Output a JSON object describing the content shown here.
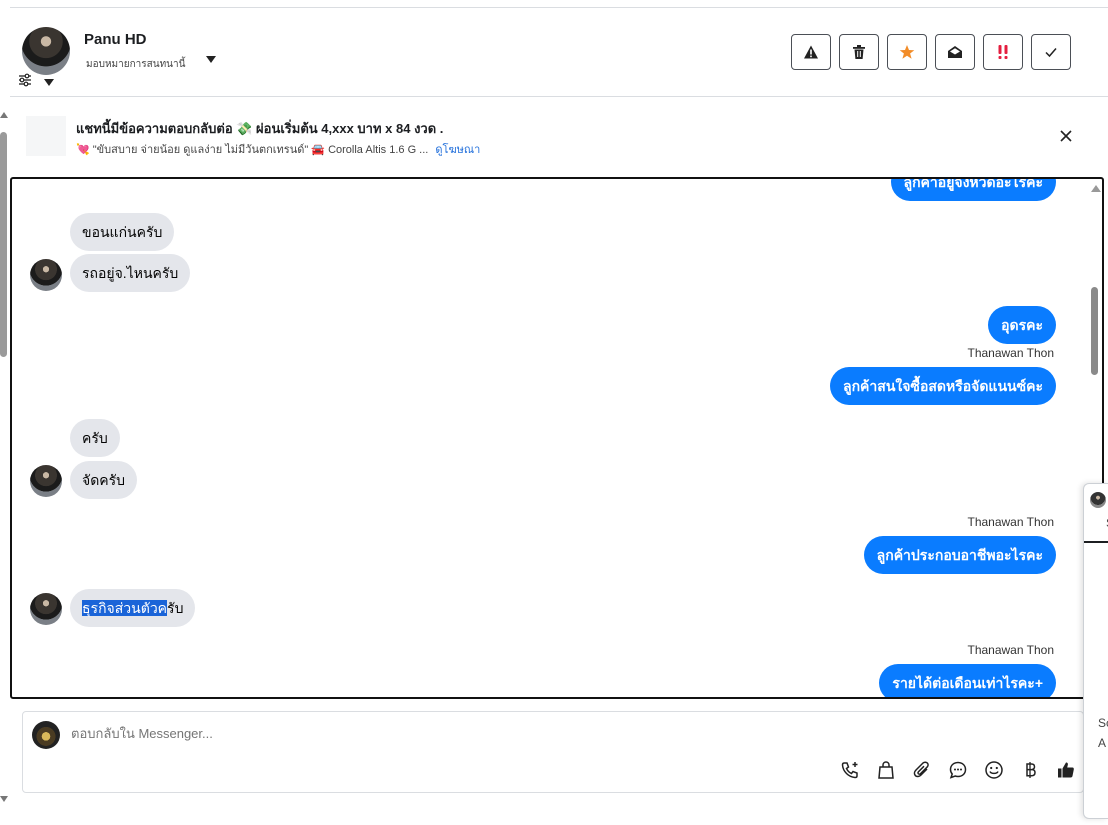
{
  "header": {
    "name": "Panu HD",
    "assign_label": "มอบหมายการสนทนานี้",
    "actions": [
      {
        "id": "report",
        "icon": "warning-icon"
      },
      {
        "id": "delete",
        "icon": "trash-icon"
      },
      {
        "id": "star",
        "icon": "star-icon"
      },
      {
        "id": "mark_unread",
        "icon": "envelope-open-icon"
      },
      {
        "id": "important",
        "icon": "exclamation-icon"
      },
      {
        "id": "done",
        "icon": "check-icon"
      }
    ]
  },
  "ad": {
    "title": "แชทนี้มีข้อความตอบกลับต่อ 💸 ผ่อนเริ่มต้น 4,xxx บาท x 84 งวด .",
    "subtitle": "💘 \"ขับสบาย จ่ายน้อย ดูแลง่าย ไม่มีวันตกเทรนด์\" 🚘 Corolla Altis 1.6 G ...",
    "link_label": "ดูโฆษณา"
  },
  "messages": {
    "m0": "ลูกค้าอยู่จังหวัดอะไรคะ",
    "m1": "ขอนแก่นครับ",
    "m2": "รถอยู่จ.ไหนครับ",
    "m3": "อุดรคะ",
    "s1": "Thanawan Thon",
    "m4": "ลูกค้าสนใจซื้อสดหรือจัดแนนซ์คะ",
    "m5": "ครับ",
    "m6": "จัดครับ",
    "s2": "Thanawan Thon",
    "m7": "ลูกค้าประกอบอาชีพอะไรคะ",
    "m8_selected": "ธุรกิจส่วนตัวค",
    "m8_rest": "รับ",
    "s3": "Thanawan Thon",
    "m9": "รายได้ต่อเดือนเท่าไรคะ+"
  },
  "composer": {
    "placeholder": "ตอบกลับใน Messenger...",
    "tools": [
      "call-add-icon",
      "bag-icon",
      "paperclip-icon",
      "chat-bubble-icon",
      "emoji-icon",
      "baht-icon",
      "thumbs-up-icon"
    ]
  },
  "side_popup": {
    "frag1": "S",
    "frag2": "Sc",
    "frag3": "A"
  },
  "colors": {
    "outgoing_bubble": "#0a7cff",
    "incoming_bubble": "#e4e6eb",
    "link": "#216fdb",
    "star": "#f28c28",
    "important": "#e41e3f"
  }
}
